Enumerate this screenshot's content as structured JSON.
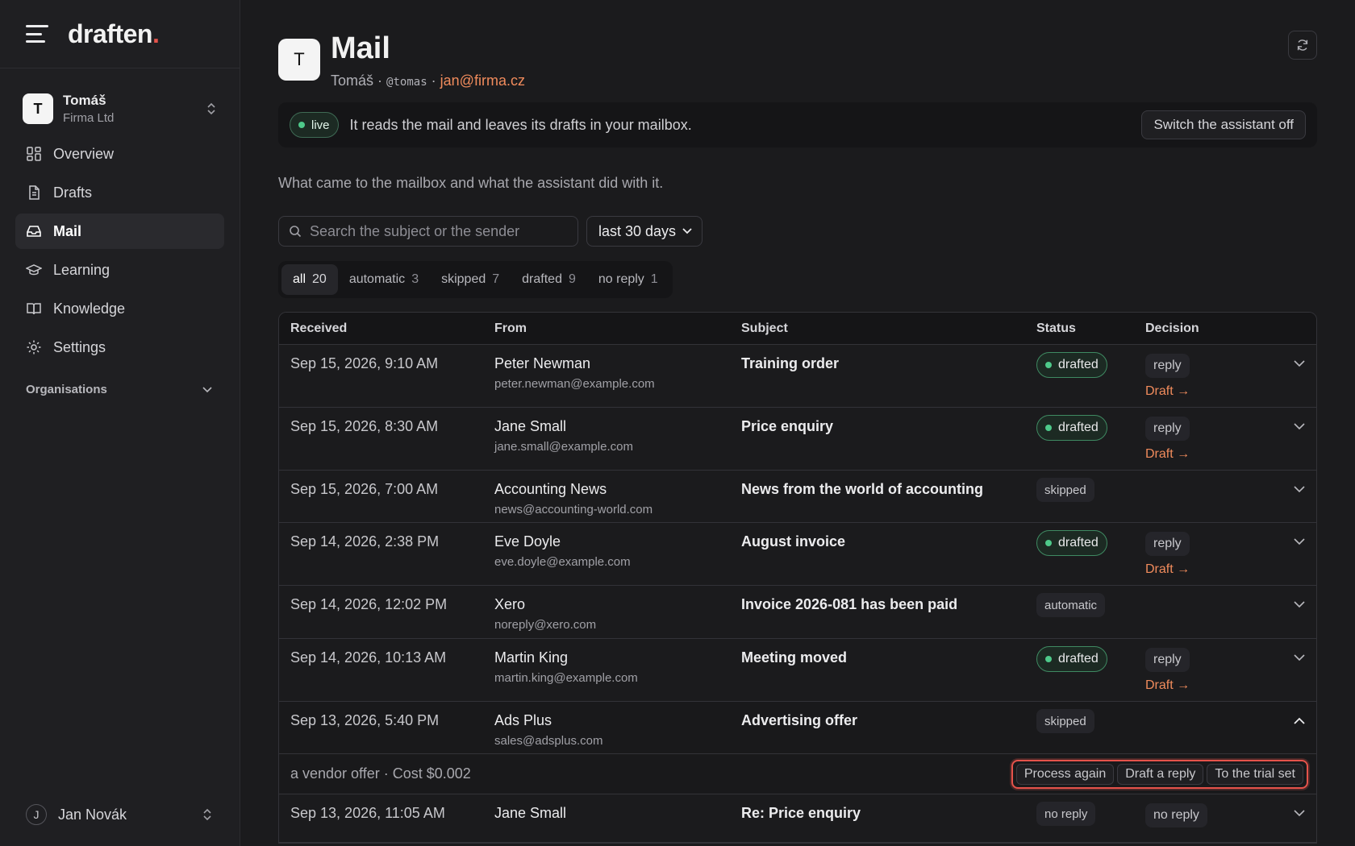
{
  "brand": {
    "name": "draften",
    "dot": "."
  },
  "account": {
    "initial": "T",
    "name": "Tomáš",
    "org": "Firma Ltd"
  },
  "nav": [
    {
      "label": "Overview",
      "icon": "grid-icon"
    },
    {
      "label": "Drafts",
      "icon": "document-icon"
    },
    {
      "label": "Mail",
      "icon": "inbox-icon",
      "active": true
    },
    {
      "label": "Learning",
      "icon": "graduation-cap-icon"
    },
    {
      "label": "Knowledge",
      "icon": "book-icon"
    },
    {
      "label": "Settings",
      "icon": "gear-icon"
    }
  ],
  "organisations_label": "Organisations",
  "user": {
    "initial": "J",
    "name": "Jan Novák"
  },
  "header": {
    "avatar": "T",
    "title": "Mail",
    "name": "Tomáš",
    "sep": "·",
    "handle": "@tomas",
    "email": "jan@firma.cz"
  },
  "banner": {
    "status": "live",
    "text": "It reads the mail and leaves its drafts in your mailbox.",
    "button": "Switch the assistant off"
  },
  "caption": "What came to the mailbox and what the assistant did with it.",
  "search": {
    "placeholder": "Search the subject or the sender"
  },
  "period": "last 30 days",
  "tabs": [
    {
      "label": "all",
      "count": "20",
      "active": true
    },
    {
      "label": "automatic",
      "count": "3"
    },
    {
      "label": "skipped",
      "count": "7"
    },
    {
      "label": "drafted",
      "count": "9"
    },
    {
      "label": "no reply",
      "count": "1"
    }
  ],
  "columns": {
    "received": "Received",
    "from": "From",
    "subject": "Subject",
    "status": "Status",
    "decision": "Decision"
  },
  "draft_link": "Draft →",
  "rows": [
    {
      "date": "Sep 15, 2026, 9:10 AM",
      "name": "Peter Newman",
      "email": "peter.newman@example.com",
      "subject": "Training order",
      "status": "drafted",
      "decision": "reply"
    },
    {
      "date": "Sep 15, 2026, 8:30 AM",
      "name": "Jane Small",
      "email": "jane.small@example.com",
      "subject": "Price enquiry",
      "status": "drafted",
      "decision": "reply"
    },
    {
      "date": "Sep 15, 2026, 7:00 AM",
      "name": "Accounting News",
      "email": "news@accounting-world.com",
      "subject": "News from the world of accounting",
      "status": "skipped",
      "decision": ""
    },
    {
      "date": "Sep 14, 2026, 2:38 PM",
      "name": "Eve Doyle",
      "email": "eve.doyle@example.com",
      "subject": "August invoice",
      "status": "drafted",
      "decision": "reply"
    },
    {
      "date": "Sep 14, 2026, 12:02 PM",
      "name": "Xero",
      "email": "noreply@xero.com",
      "subject": "Invoice 2026-081 has been paid",
      "status": "automatic",
      "decision": ""
    },
    {
      "date": "Sep 14, 2026, 10:13 AM",
      "name": "Martin King",
      "email": "martin.king@example.com",
      "subject": "Meeting moved",
      "status": "drafted",
      "decision": "reply"
    },
    {
      "date": "Sep 13, 2026, 5:40 PM",
      "name": "Ads Plus",
      "email": "sales@adsplus.com",
      "subject": "Advertising offer",
      "status": "skipped",
      "decision": "",
      "expanded": true
    },
    {
      "date": "Sep 13, 2026, 11:05 AM",
      "name": "Jane Small",
      "email": "",
      "subject": "Re: Price enquiry",
      "status": "no reply",
      "decision": "no reply"
    }
  ],
  "expanded_detail": {
    "text": "a vendor offer · Cost $0.002",
    "actions": [
      "Process again",
      "Draft a reply",
      "To the trial set"
    ]
  },
  "colors": {
    "accent": "#f08b5c",
    "brand_dot": "#e5534b",
    "live_green": "#4ec98a",
    "highlight": "#e5534b"
  }
}
